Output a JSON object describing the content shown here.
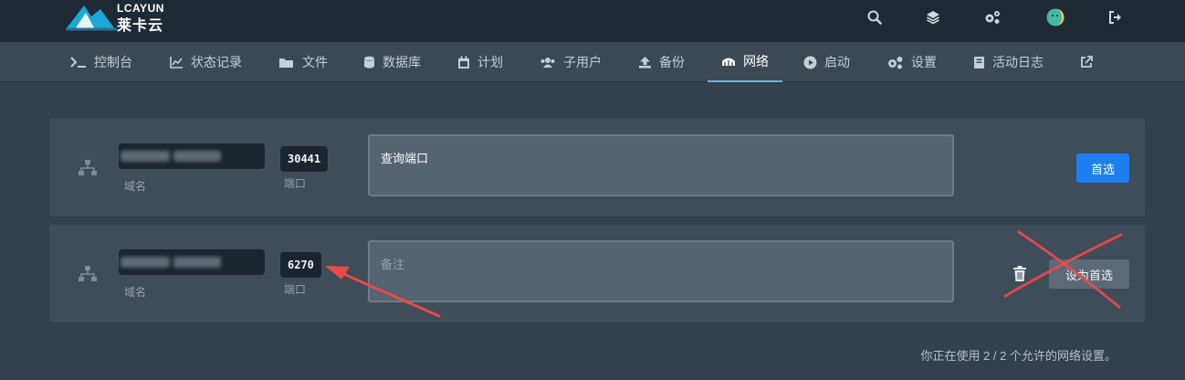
{
  "brand": {
    "name": "LCAYUN",
    "chinese": "莱卡云"
  },
  "header": {
    "icons": [
      "search-icon",
      "layers-icon",
      "settings-icon",
      "avatar",
      "logout-icon"
    ]
  },
  "nav": {
    "items": [
      {
        "label": "控制台",
        "icon": "terminal-icon"
      },
      {
        "label": "状态记录",
        "icon": "chart-icon"
      },
      {
        "label": "文件",
        "icon": "folder-icon"
      },
      {
        "label": "数据库",
        "icon": "database-icon"
      },
      {
        "label": "计划",
        "icon": "calendar-icon"
      },
      {
        "label": "子用户",
        "icon": "users-icon"
      },
      {
        "label": "备份",
        "icon": "upload-icon"
      },
      {
        "label": "网络",
        "icon": "network-icon",
        "active": true
      },
      {
        "label": "启动",
        "icon": "play-icon"
      },
      {
        "label": "设置",
        "icon": "gears-icon"
      },
      {
        "label": "活动日志",
        "icon": "book-icon"
      },
      {
        "label": "",
        "icon": "external-link-icon"
      }
    ]
  },
  "allocations": [
    {
      "domain_label": "域名",
      "port": "30441",
      "port_label": "端口",
      "note": "查询端口",
      "button": "首选",
      "primary": true
    },
    {
      "domain_label": "域名",
      "port": "6270",
      "port_label": "端口",
      "note_placeholder": "备注",
      "button": "设为首选",
      "primary": false
    }
  ],
  "footer": {
    "usage": "你正在使用 2 / 2 个允许的网络设置。"
  },
  "colors": {
    "accent": "#1e7ef0",
    "active_tab": "#5bb8e8",
    "annotation_red": "#e94b4b"
  }
}
